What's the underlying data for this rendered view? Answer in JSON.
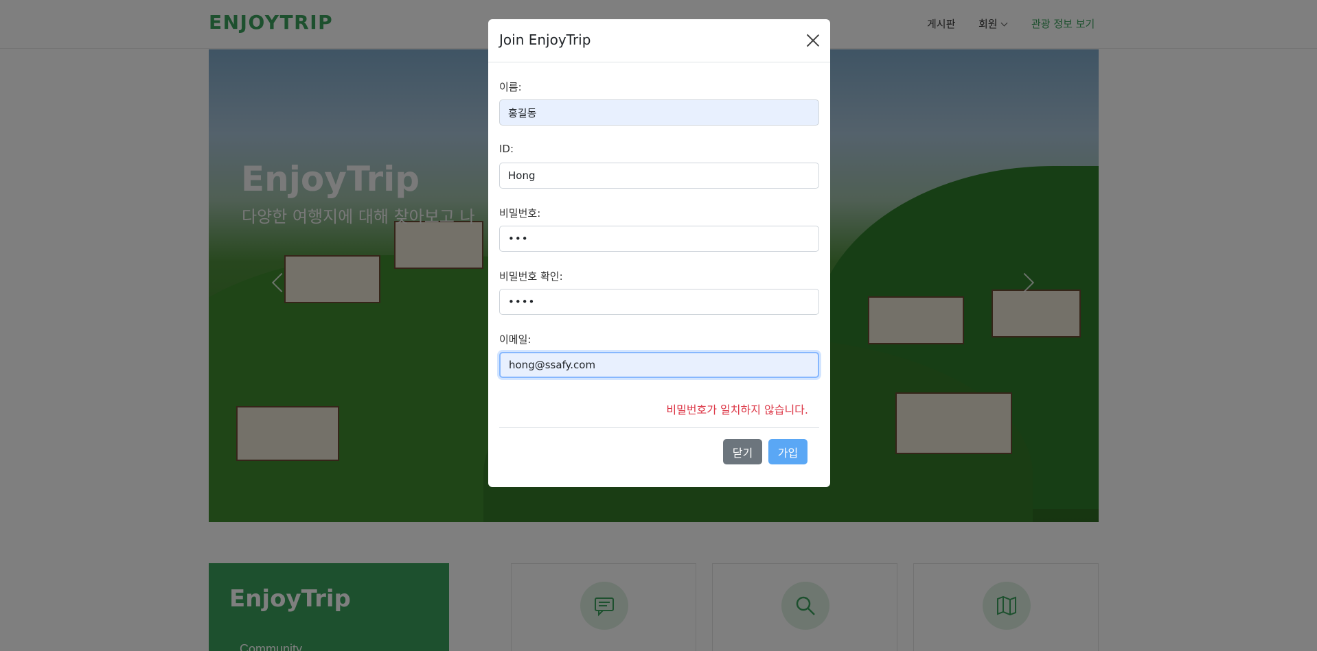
{
  "navbar": {
    "brand": "ENJOYTRIP",
    "items": [
      {
        "label": "게시판"
      },
      {
        "label": "회원"
      },
      {
        "label": "관광 정보 보기"
      }
    ]
  },
  "hero": {
    "title": "EnjoyTrip",
    "subtitle": "다양한 여행지에 대해 찾아보고 나"
  },
  "bottom": {
    "green_card_title": "EnjoyTrip",
    "green_card_sub": "Community",
    "feature_icons": [
      "chat-icon",
      "search-icon",
      "map-icon"
    ]
  },
  "modal": {
    "title": "Join EnjoyTrip",
    "fields": {
      "name": {
        "label": "이름:",
        "value": "홍길동"
      },
      "id": {
        "label": "ID:",
        "value": "Hong"
      },
      "password": {
        "label": "비밀번호:",
        "value": "•••"
      },
      "password_confirm": {
        "label": "비밀번호 확인:",
        "value": "••••"
      },
      "email": {
        "label": "이메일:",
        "value": "hong@ssafy.com"
      }
    },
    "error": "비밀번호가 일치하지 않습니다.",
    "buttons": {
      "close": "닫기",
      "join": "가입"
    }
  },
  "colors": {
    "brand": "#3aa15c",
    "error": "#dc3545",
    "primary": "#5aa7f5",
    "secondary": "#6c757d"
  }
}
